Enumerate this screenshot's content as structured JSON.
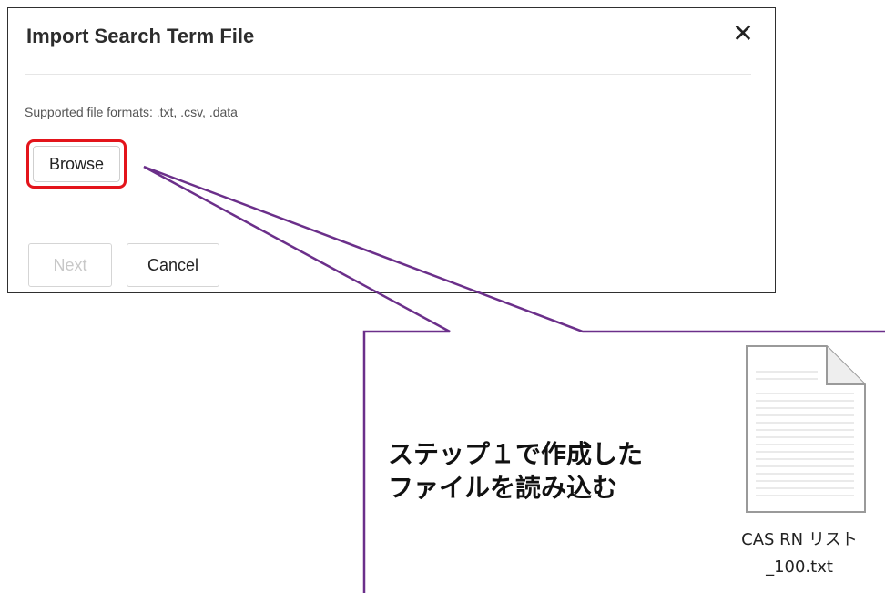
{
  "dialog": {
    "title": "Import Search Term File",
    "close_icon": "close-icon",
    "close_glyph": "✕",
    "formats_text": "Supported file formats: .txt, .csv, .data",
    "browse_label": "Browse",
    "next_label": "Next",
    "cancel_label": "Cancel"
  },
  "callout": {
    "line1": "ステップ１で作成した",
    "line2": "ファイルを読み込む",
    "color": "#6b2f8a"
  },
  "file": {
    "icon": "text-file-icon",
    "name_line1": "CAS RN リスト",
    "name_line2": "_100.txt"
  },
  "colors": {
    "highlight": "#e3141b",
    "disabled_text": "#c8c8c8"
  }
}
